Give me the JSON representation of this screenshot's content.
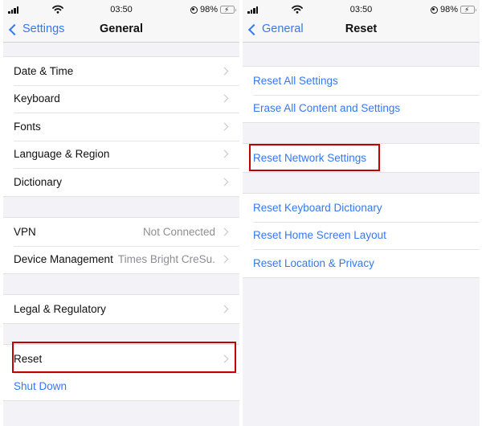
{
  "status_bar": {
    "time": "03:50",
    "battery_percent": "98%",
    "icons": [
      "signal-icon",
      "wifi-icon",
      "orientation-lock-icon",
      "battery-charging-icon"
    ]
  },
  "left_screen": {
    "nav": {
      "back_label": "Settings",
      "title": "General"
    },
    "groups": [
      {
        "rows": [
          {
            "label": "Date & Time",
            "chevron": true
          },
          {
            "label": "Keyboard",
            "chevron": true
          },
          {
            "label": "Fonts",
            "chevron": true
          },
          {
            "label": "Language & Region",
            "chevron": true
          },
          {
            "label": "Dictionary",
            "chevron": true
          }
        ]
      },
      {
        "rows": [
          {
            "label": "VPN",
            "value": "Not Connected",
            "chevron": true
          },
          {
            "label": "Device Management",
            "value": "Times Bright CreSu...",
            "chevron": true
          }
        ]
      },
      {
        "rows": [
          {
            "label": "Legal & Regulatory",
            "chevron": true
          }
        ]
      },
      {
        "rows": [
          {
            "label": "Reset",
            "chevron": true,
            "highlighted": true
          },
          {
            "label": "Shut Down",
            "style": "blue"
          }
        ]
      }
    ]
  },
  "right_screen": {
    "nav": {
      "back_label": "General",
      "title": "Reset"
    },
    "groups": [
      {
        "rows": [
          {
            "label": "Reset All Settings"
          },
          {
            "label": "Erase All Content and Settings"
          }
        ]
      },
      {
        "rows": [
          {
            "label": "Reset Network Settings",
            "highlighted": true
          }
        ]
      },
      {
        "rows": [
          {
            "label": "Reset Keyboard Dictionary"
          },
          {
            "label": "Reset Home Screen Layout"
          },
          {
            "label": "Reset Location & Privacy"
          }
        ]
      }
    ]
  },
  "colors": {
    "accent_blue": "#3478f6",
    "highlight_red": "#c00000",
    "grouped_background": "#f2f2f7",
    "secondary_text": "#8e8e93"
  }
}
